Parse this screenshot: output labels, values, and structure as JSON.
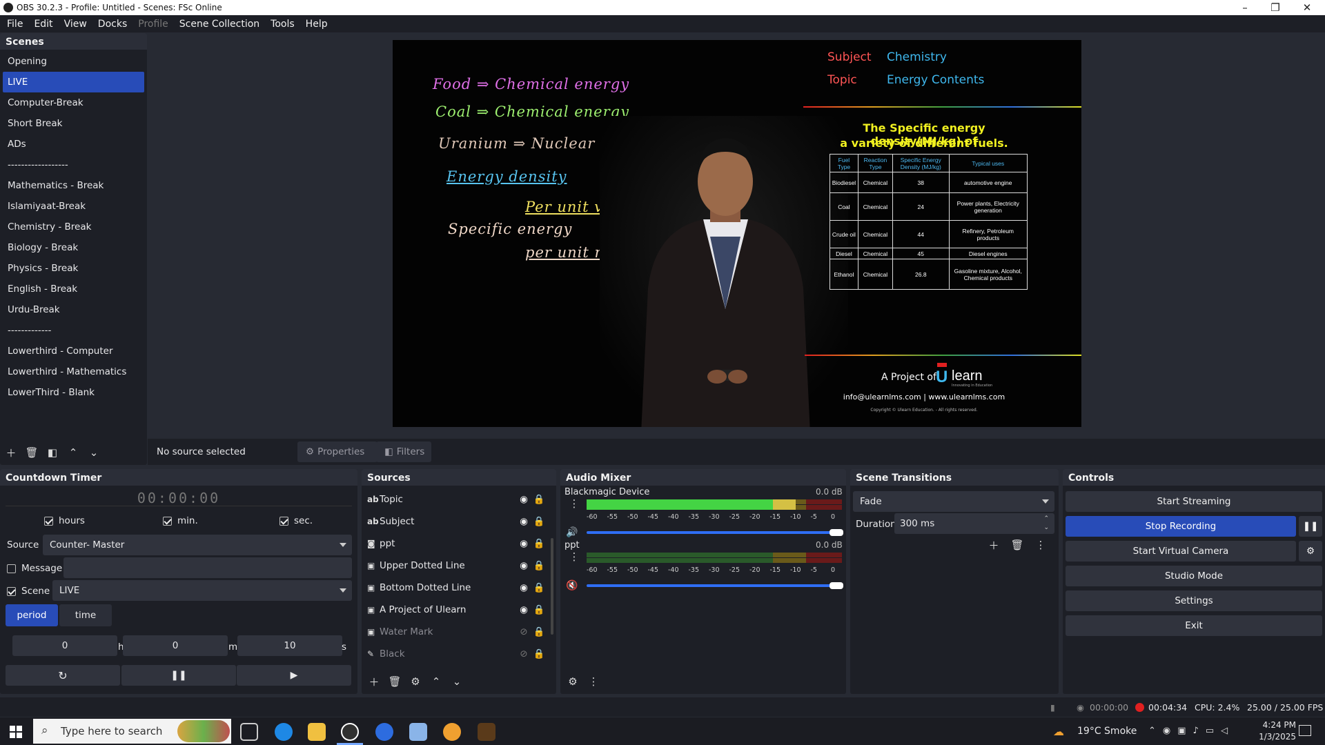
{
  "window": {
    "title": "OBS 30.2.3 - Profile: Untitled - Scenes: FSc Online"
  },
  "menu": [
    "File",
    "Edit",
    "View",
    "Docks",
    "Profile",
    "Scene Collection",
    "Tools",
    "Help"
  ],
  "scenes": {
    "title": "Scenes",
    "items": [
      "Opening",
      "LIVE",
      "Computer-Break",
      "Short Break",
      "ADs",
      "------------------",
      "Mathematics  - Break",
      "Islamiyaat-Break",
      "Chemistry  - Break",
      "Biology  - Break",
      "Physics  - Break",
      "English - Break",
      "Urdu-Break",
      "-------------",
      "Lowerthird - Computer",
      "Lowerthird - Mathematics",
      "LowerThird - Blank"
    ],
    "selected": 1
  },
  "preview": {
    "board": [
      "Food ⇒ Chemical energy",
      "Coal ⇒ Chemical energy",
      "Uranium ⇒ Nuclear energy",
      "Energy density",
      "Per unit volume",
      "Specific energy",
      "per unit mass"
    ],
    "subject_label": "Subject",
    "subject_value": "Chemistry",
    "topic_label": "Topic",
    "topic_value": "Energy Contents",
    "table_title_1": "The Specific energy density(MJ/kg) of",
    "table_title_2": "a variety of different fuels.",
    "table_headers": [
      "Fuel Type",
      "Reaction Type",
      "Specific Energy Density (MJ/kg)",
      "Typical uses"
    ],
    "table_rows": [
      [
        "Biodiesel",
        "Chemical",
        "38",
        "automotive engine"
      ],
      [
        "Coal",
        "Chemical",
        "24",
        "Power plants, Electricity generation"
      ],
      [
        "Crude oil",
        "Chemical",
        "44",
        "Refinery, Petroleum products"
      ],
      [
        "Diesel",
        "Chemical",
        "45",
        "Diesel engines"
      ],
      [
        "Ethanol",
        "Chemical",
        "26.8",
        "Gasoline mixture, Alcohol, Chemical products"
      ]
    ],
    "project_text": "A Project of",
    "logo_text": "learn",
    "logo_letter": "U",
    "logo_tagline": "Innovating in Education",
    "contact": "info@ulearnlms.com | www.ulearnlms.com",
    "copyright": "Copyright © Ulearn Education. - All rights reserved."
  },
  "context": {
    "no_source": "No source selected",
    "properties": "Properties",
    "filters": "Filters"
  },
  "countdown": {
    "title": "Countdown Timer",
    "display": "00:00:00",
    "hours_label": "hours",
    "min_label": "min.",
    "sec_label": "sec.",
    "source_label": "Source",
    "source_value": "Counter- Master",
    "message_label": "Message",
    "scene_label": "Scene",
    "scene_value": "LIVE",
    "tab_period": "period",
    "tab_time": "time",
    "h_value": "0",
    "h_unit": "h",
    "m_value": "0",
    "m_unit": "m",
    "s_value": "10",
    "s_unit": "s"
  },
  "sources": {
    "title": "Sources",
    "items": [
      {
        "icon": "ab",
        "name": "Topic",
        "visible": true
      },
      {
        "icon": "ab",
        "name": "Subject",
        "visible": true
      },
      {
        "icon": "cam",
        "name": "ppt",
        "visible": true
      },
      {
        "icon": "img",
        "name": "Upper Dotted Line",
        "visible": true
      },
      {
        "icon": "img",
        "name": "Bottom Dotted Line",
        "visible": true
      },
      {
        "icon": "img",
        "name": "A Project of Ulearn",
        "visible": true
      },
      {
        "icon": "img",
        "name": "Water Mark",
        "visible": false
      },
      {
        "icon": "brush",
        "name": "Black",
        "visible": false
      }
    ]
  },
  "mixer": {
    "title": "Audio Mixer",
    "scale": [
      "-60",
      "-55",
      "-50",
      "-45",
      "-40",
      "-35",
      "-30",
      "-25",
      "-20",
      "-15",
      "-10",
      "-5",
      "0"
    ],
    "channels": [
      {
        "name": "Blackmagic Device",
        "db": "0.0 dB",
        "level": 0.82,
        "muted": false,
        "volume": 1.0
      },
      {
        "name": "ppt",
        "db": "0.0 dB",
        "level": 0,
        "muted": true,
        "volume": 1.0
      }
    ]
  },
  "transitions": {
    "title": "Scene Transitions",
    "type": "Fade",
    "duration_label": "Duration",
    "duration_value": "300 ms"
  },
  "controls": {
    "title": "Controls",
    "start_streaming": "Start Streaming",
    "stop_recording": "Stop Recording",
    "start_virtual_camera": "Start Virtual Camera",
    "studio_mode": "Studio Mode",
    "settings": "Settings",
    "exit": "Exit"
  },
  "status": {
    "stream_time": "00:00:00",
    "rec_time": "00:04:34",
    "cpu": "CPU: 2.4%",
    "fps": "25.00 / 25.00 FPS"
  },
  "taskbar": {
    "search_placeholder": "Type here to search",
    "weather": "19°C  Smoke",
    "time": "4:24 PM",
    "date": "1/3/2025"
  },
  "colors": {
    "accent": "#284cb8",
    "dock_bg": "#1d1f26",
    "panel_bg": "#272a33",
    "record": "#e02020"
  }
}
